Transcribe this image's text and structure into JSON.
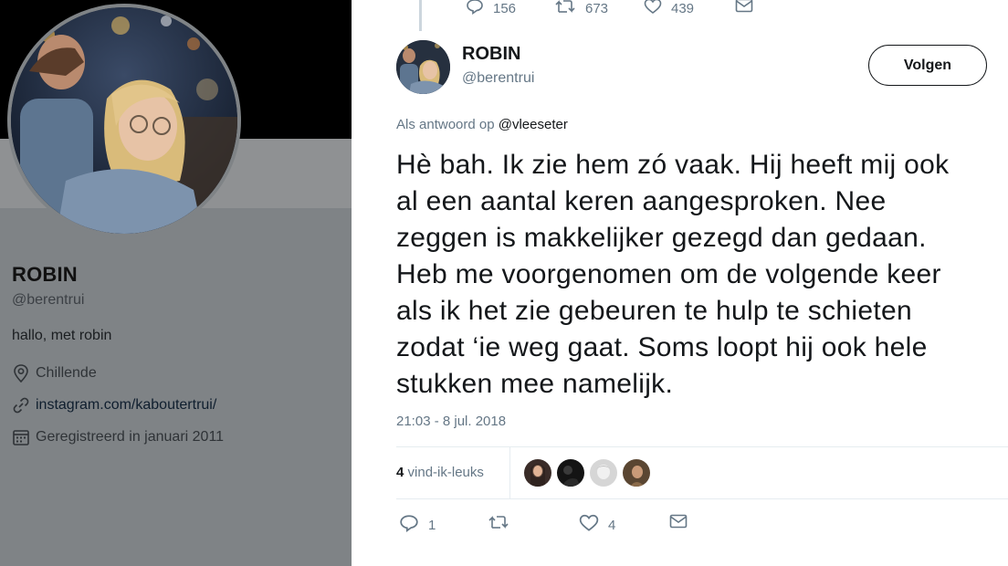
{
  "profile": {
    "name": "ROBIN",
    "handle": "@berentrui",
    "bio": "hallo, met robin",
    "location": "Chillende",
    "website": "instagram.com/kaboutertrui/",
    "joined": "Geregistreerd in januari 2011",
    "icons": [
      "location-pin-icon",
      "link-icon",
      "calendar-icon"
    ]
  },
  "previous_tweet": {
    "replies": "156",
    "retweets": "673",
    "likes": "439"
  },
  "tweet": {
    "author_name": "ROBIN",
    "author_handle": "@berentrui",
    "follow_label": "Volgen",
    "reply_prefix": "Als antwoord op",
    "reply_mention": "@vleeseter",
    "text": "Hè bah. Ik zie hem zó vaak. Hij heeft mij ook al een aantal keren aangesproken. Nee zeggen is makkelijker gezegd dan gedaan. Heb me voorgenomen om de volgende keer als ik het zie gebeuren te hulp te schieten zodat ‘ie weg gaat. Soms loopt hij ook hele stukken mee namelijk.",
    "text_lines": [
      "Hè bah. Ik zie hem zó vaak. Hij heeft mij ook",
      "al een aantal keren aangesproken. Nee",
      "zeggen is makkelijker gezegd dan gedaan.",
      "Heb me voorgenomen om de volgende keer",
      "als ik het zie gebeuren te hulp te schieten",
      "zodat ‘ie weg gaat. Soms loopt hij ook hele",
      "stukken mee namelijk."
    ],
    "timestamp": "21:03 - 8 jul. 2018",
    "like_count": "4",
    "like_label": "vind-ik-leuks",
    "actions": {
      "replies": "1",
      "retweets": "",
      "likes": "4"
    }
  },
  "colors": {
    "text": "#14171a",
    "secondary": "#657786",
    "divider": "#e6ecf0",
    "dim_panel": "#7f8386"
  }
}
